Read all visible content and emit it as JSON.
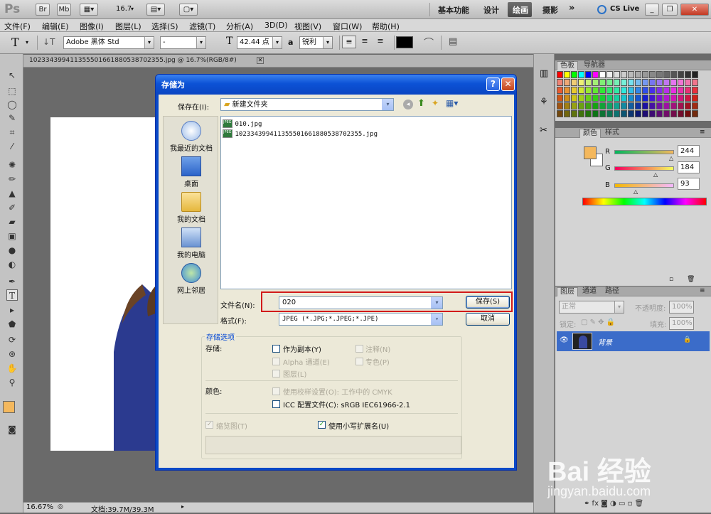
{
  "app": {
    "logo": "Ps",
    "title_buttons": [
      "Br",
      "Mb"
    ],
    "zoom": "16.7",
    "workspaces": [
      "基本功能",
      "设计",
      "绘画",
      "摄影"
    ],
    "active_workspace": "绘画",
    "more": "»",
    "cslive": "CS Live"
  },
  "menu": [
    "文件(F)",
    "编辑(E)",
    "图像(I)",
    "图层(L)",
    "选择(S)",
    "滤镜(T)",
    "分析(A)",
    "3D(D)",
    "视图(V)",
    "窗口(W)",
    "帮助(H)"
  ],
  "options": {
    "font_family": "Adobe 黑体 Std",
    "font_style": "-",
    "font_size": "42.44 点",
    "aa_label": "a",
    "antialias": "锐利"
  },
  "document": {
    "tab_title": "10233439941135550166188053870235​5.jpg @ 16.7%(RGB/8#)",
    "status_zoom": "16.67%",
    "status_doc": "文档:39.7M/39.3M"
  },
  "panels": {
    "swatches_tab": "色板",
    "navigator_tab": "导航器",
    "color_tab": "颜色",
    "styles_tab": "样式",
    "r_label": "R",
    "g_label": "G",
    "b_label": "B",
    "r": "244",
    "g": "184",
    "b": "93",
    "foreground_color": "#f4b85d",
    "layers_tab": "图层",
    "channels_tab": "通道",
    "paths_tab": "路径",
    "blend_mode": "正常",
    "opacity_label": "不透明度:",
    "opacity": "100%",
    "lock_label": "锁定:",
    "fill_label": "填充:",
    "fill": "100%",
    "layer_name": "背景"
  },
  "dialog": {
    "title": "存储为",
    "save_in_label": "保存在(I):",
    "save_in_value": "新建文件夹",
    "places": [
      "我最近的文档",
      "桌面",
      "我的文档",
      "我的电脑",
      "网上邻居"
    ],
    "files": [
      "010.jpg",
      "10233439941135550166188053870235​5.jpg"
    ],
    "file_icon": "JPEG",
    "filename_label": "文件名(N):",
    "filename_value": "020",
    "format_label": "格式(F):",
    "format_value": "JPEG (*.JPG;*.JPEG;*.JPE)",
    "save_button": "保存(S)",
    "cancel_button": "取消",
    "options_title": "存储选项",
    "store_label": "存储:",
    "as_copy": "作为副本(Y)",
    "notes": "注释(N)",
    "alpha": "Alpha 通道(E)",
    "spot": "专色(P)",
    "layers": "图层(L)",
    "color_label": "颜色:",
    "proof": "使用校样设置(O):  工作中的 CMYK",
    "icc": "ICC 配置文件(C):  sRGB IEC61966-2.1",
    "thumbnail": "缩览图(T)",
    "lowercase_ext": "使用小写扩展名(U)"
  },
  "watermark": {
    "brand": "Bai 经验",
    "url": "jingyan.baidu.com"
  }
}
